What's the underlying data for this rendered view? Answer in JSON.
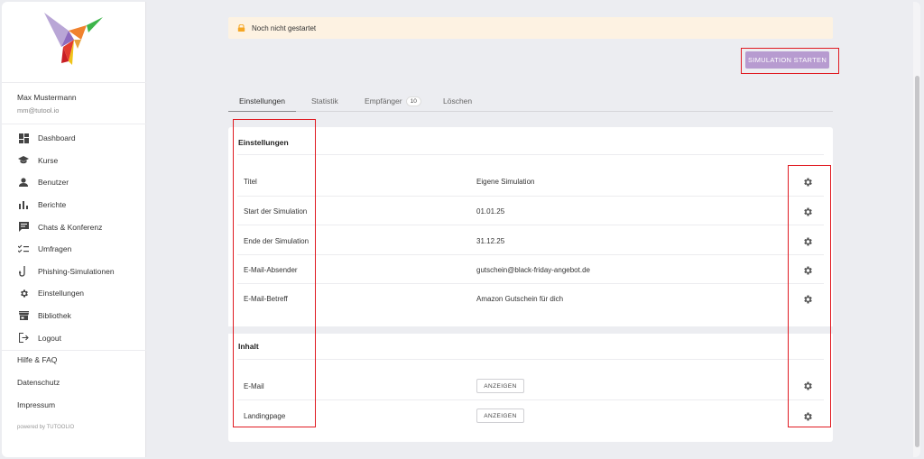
{
  "sidebar": {
    "user": {
      "name": "Max Mustermann",
      "email": "mm@tutool.io"
    },
    "items": [
      {
        "label": "Dashboard",
        "icon": "dashboard-icon"
      },
      {
        "label": "Kurse",
        "icon": "graduation-cap-icon"
      },
      {
        "label": "Benutzer",
        "icon": "user-icon"
      },
      {
        "label": "Berichte",
        "icon": "bar-chart-icon"
      },
      {
        "label": "Chats & Konferenz",
        "icon": "chat-icon"
      },
      {
        "label": "Umfragen",
        "icon": "checklist-icon"
      },
      {
        "label": "Phishing-Simulationen",
        "icon": "hook-icon"
      },
      {
        "label": "Einstellungen",
        "icon": "gear-icon"
      },
      {
        "label": "Bibliothek",
        "icon": "store-icon"
      },
      {
        "label": "Logout",
        "icon": "logout-icon"
      }
    ],
    "links": [
      "Hilfe & FAQ",
      "Datenschutz",
      "Impressum"
    ],
    "powered_by": "powered by TUTOOLIO"
  },
  "status": {
    "text": "Noch nicht gestartet",
    "icon": "lock-icon",
    "color": "#fdf2e2"
  },
  "actions": {
    "start_simulation": "SIMULATION STARTEN"
  },
  "tabs": [
    {
      "label": "Einstellungen",
      "active": true
    },
    {
      "label": "Statistik"
    },
    {
      "label": "Empfänger",
      "badge": "10"
    },
    {
      "label": "Löschen"
    }
  ],
  "settings": {
    "title": "Einstellungen",
    "rows": [
      {
        "label": "Titel",
        "value": "Eigene Simulation"
      },
      {
        "label": "Start der Simulation",
        "value": "01.01.25"
      },
      {
        "label": "Ende der Simulation",
        "value": "31.12.25"
      },
      {
        "label": "E-Mail-Absender",
        "value": "gutschein@black-friday-angebot.de"
      },
      {
        "label": "E-Mail-Betreff",
        "value": "Amazon Gutschein für dich"
      }
    ]
  },
  "content": {
    "title": "Inhalt",
    "rows": [
      {
        "label": "E-Mail",
        "button": "ANZEIGEN"
      },
      {
        "label": "Landingpage",
        "button": "ANZEIGEN"
      }
    ]
  },
  "colors": {
    "accent": "#b79bd0",
    "highlight": "#e01b22",
    "banner": "#fdf2e2"
  }
}
